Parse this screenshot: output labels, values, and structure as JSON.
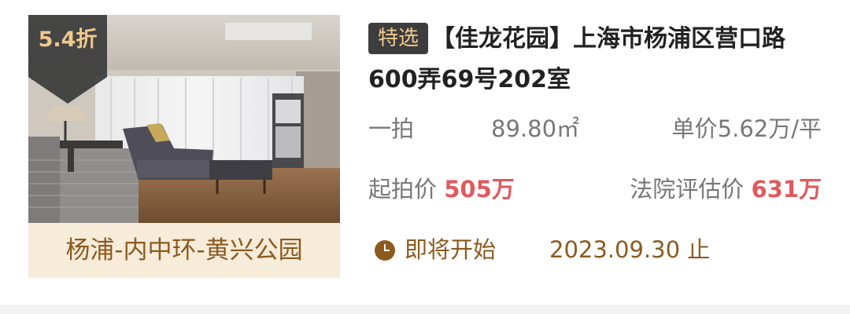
{
  "listing": {
    "discount": "5.4折",
    "location": "杨浦-内中环-黄兴公园",
    "tag": "特选",
    "title": "【佳龙花园】上海市杨浦区营口路600弄69号202室",
    "auction_round": "一拍",
    "area": "89.80㎡",
    "unit_price": "单价5.62万/平",
    "start_price_label": "起拍价",
    "start_price_value": "505万",
    "eval_price_label": "法院评估价",
    "eval_price_value": "631万",
    "status_label": "即将开始",
    "end_date": "2023.09.30 止",
    "icon": "clock-icon"
  },
  "colors": {
    "accent": "#e0595d",
    "brown": "#8c5a1e",
    "tag_bg": "#3d3d3d",
    "tag_text": "#f0c98c",
    "location_bg": "#f7ebd9"
  }
}
